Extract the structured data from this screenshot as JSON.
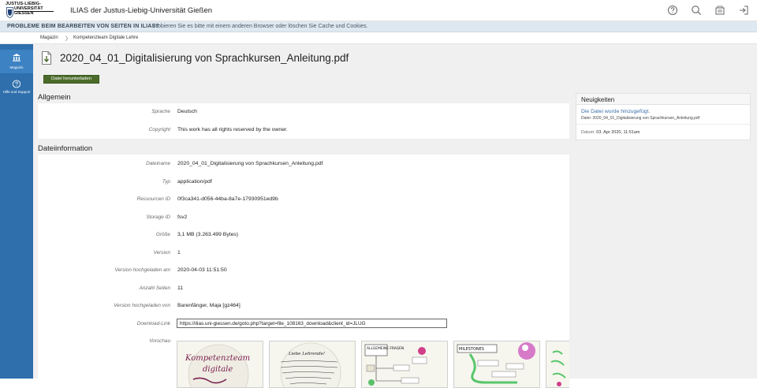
{
  "header": {
    "logo_line1": "JUSTUS-LIEBIG-",
    "logo_line2": "UNIVERSITÄT",
    "logo_line3": "GIESSEN",
    "site_title": "ILIAS der Justus-Liebig-Universität Gießen",
    "icons": [
      "help-icon",
      "search-icon",
      "notifications-icon",
      "logout-icon"
    ]
  },
  "notice": {
    "strong": "PROBLEME BEIM BEARBEITEN VON SEITEN IN ILIAS?",
    "message": "Probieren Sie es bitte mit einem anderen Browser oder löschen Sie Cache und Cookies."
  },
  "breadcrumb": {
    "items": [
      "Magazin",
      "Kompetenzteam Digitale Lehre"
    ],
    "separator": "〉"
  },
  "slate": {
    "items": [
      {
        "label": "Magazin",
        "icon": "repository-icon",
        "active": true
      },
      {
        "label": "Hilfe und Support",
        "icon": "support-icon",
        "active": false
      }
    ]
  },
  "page": {
    "title": "2020_04_01_Digitalisierung von Sprachkursen_Anleitung.pdf",
    "download_button": "Datei herunterladen"
  },
  "allgemein": {
    "heading": "Allgemein",
    "rows": [
      {
        "label": "Sprache",
        "value": "Deutsch"
      },
      {
        "label": "Copyright",
        "value": "This work has all rights reserved by the owner."
      }
    ]
  },
  "dateiinfo": {
    "heading": "Dateiinformation",
    "rows": [
      {
        "label": "Dateiname",
        "value": "2020_04_01_Digitalisierung von Sprachkursen_Anleitung.pdf"
      },
      {
        "label": "Typ",
        "value": "application/pdf"
      },
      {
        "label": "Ressourcen ID",
        "value": "0f3ca341-d056-44ba-8a7e-17930951ed9b"
      },
      {
        "label": "Storage ID",
        "value": "fsv2"
      },
      {
        "label": "Größe",
        "value": "3,1 MB (3.263.499 Bytes)"
      },
      {
        "label": "Version",
        "value": "1"
      },
      {
        "label": "Version hochgeladen am",
        "value": "2020-04-03 11:51:50"
      },
      {
        "label": "Anzahl Seiten",
        "value": "11"
      },
      {
        "label": "Version hochgeladen von",
        "value": "Barenfänger, Maja [gz464]"
      }
    ],
    "download_link_label": "Download-Link",
    "download_link_value": "https://ilias.uni-giessen.de/goto.php?target=file_108163_download&client_id=JLUG",
    "preview_label": "Vorschau",
    "preview_text": {
      "t1_line1": "Kompetenzteam",
      "t1_line2": "digitale",
      "t2_line1": "Liebe Lehrende!",
      "t3_heading": "ALLGEMEINE FRAGEN",
      "t4_heading": "MILESTONES"
    }
  },
  "news": {
    "heading": "Neuigkeiten",
    "item_title": "Die Datei wurde hinzugefügt.",
    "item_desc": "Datei: 2020_04_01_Digitalisierung von Sprachkursen_Anleitung.pdf",
    "date_label": "Datum:",
    "date_value": "03. Apr 2020, 11:51am"
  },
  "colors": {
    "slate": "#2e6fac",
    "button": "#4c6b2b",
    "notice_bg": "#dee8f0",
    "link": "#3b6fa8"
  }
}
